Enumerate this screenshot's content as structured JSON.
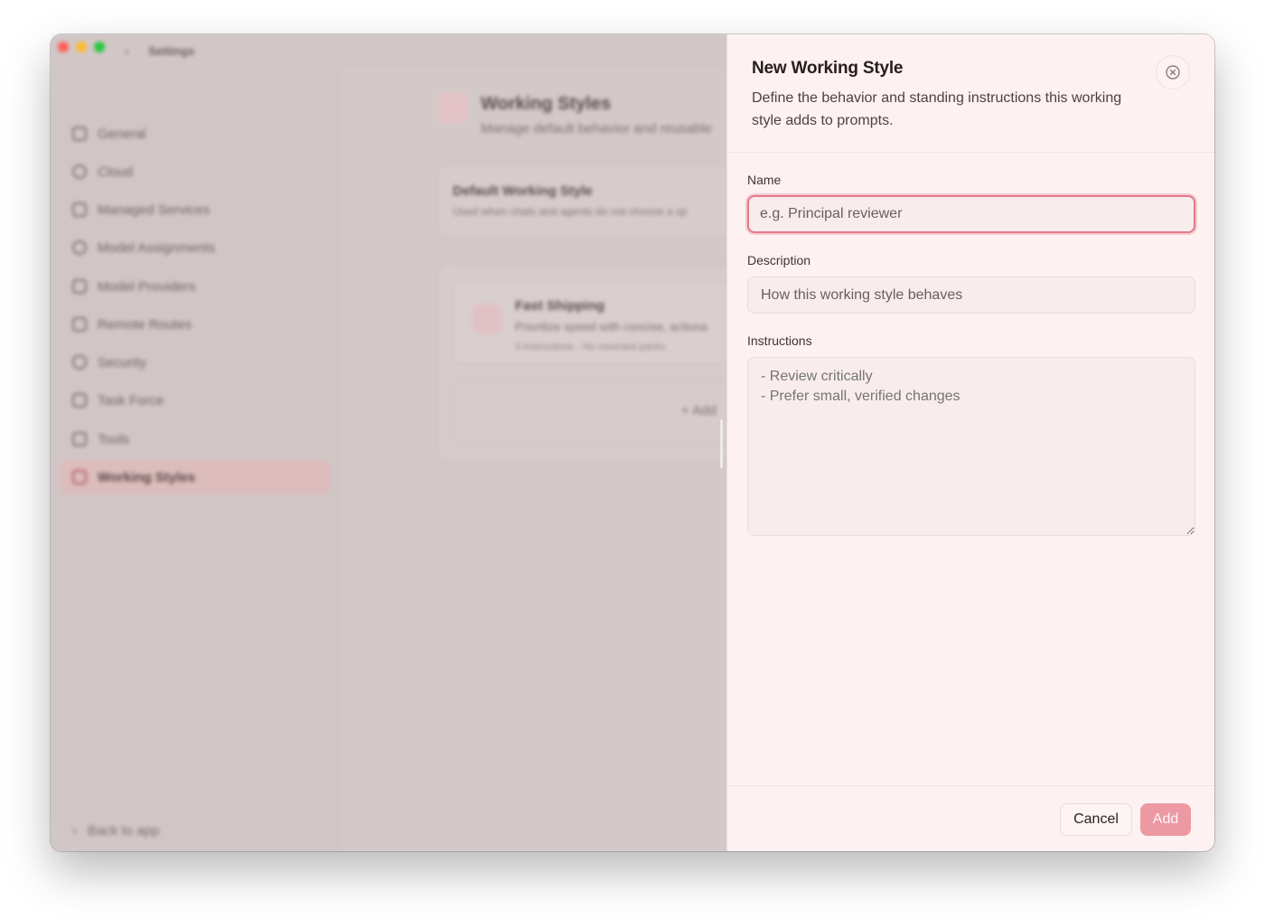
{
  "window": {
    "title": "Settings",
    "back_glyph": "‹"
  },
  "sidebar": {
    "items": [
      {
        "label": "General",
        "icon": "home-icon"
      },
      {
        "label": "Cloud",
        "icon": "cloud-icon"
      },
      {
        "label": "Managed Services",
        "icon": "services-icon"
      },
      {
        "label": "Model Assignments",
        "icon": "assignments-icon"
      },
      {
        "label": "Model Providers",
        "icon": "providers-icon"
      },
      {
        "label": "Remote Routes",
        "icon": "routes-icon"
      },
      {
        "label": "Security",
        "icon": "shield-icon"
      },
      {
        "label": "Task Force",
        "icon": "task-force-icon"
      },
      {
        "label": "Tools",
        "icon": "tools-icon"
      },
      {
        "label": "Working Styles",
        "icon": "working-styles-icon",
        "active": true
      }
    ],
    "back_to_app": "Back to app"
  },
  "main": {
    "title": "Working Styles",
    "subtitle": "Manage default behavior and reusable",
    "default_card": {
      "title": "Default Working Style",
      "subtitle": "Used when chats and agents do not choose a sp"
    },
    "style_card": {
      "title": "Fast Shipping",
      "subtitle": "Prioritize speed with concise, actiona",
      "meta": "3 instructions · No mounted packs"
    },
    "add_label": "+  Add"
  },
  "drawer": {
    "title": "New Working Style",
    "description": "Define the behavior and standing instructions this working style adds to prompts.",
    "name": {
      "label": "Name",
      "placeholder": "e.g. Principal reviewer",
      "value": ""
    },
    "desc_field": {
      "label": "Description",
      "placeholder": "How this working style behaves",
      "value": ""
    },
    "instructions": {
      "label": "Instructions",
      "placeholder": "- Review critically\n- Prefer small, verified changes",
      "value": ""
    },
    "cancel_label": "Cancel",
    "add_label": "Add"
  },
  "colors": {
    "accent": "#ec99a4",
    "focus_ring": "#e3798a",
    "drawer_bg": "#fdf2f1"
  }
}
